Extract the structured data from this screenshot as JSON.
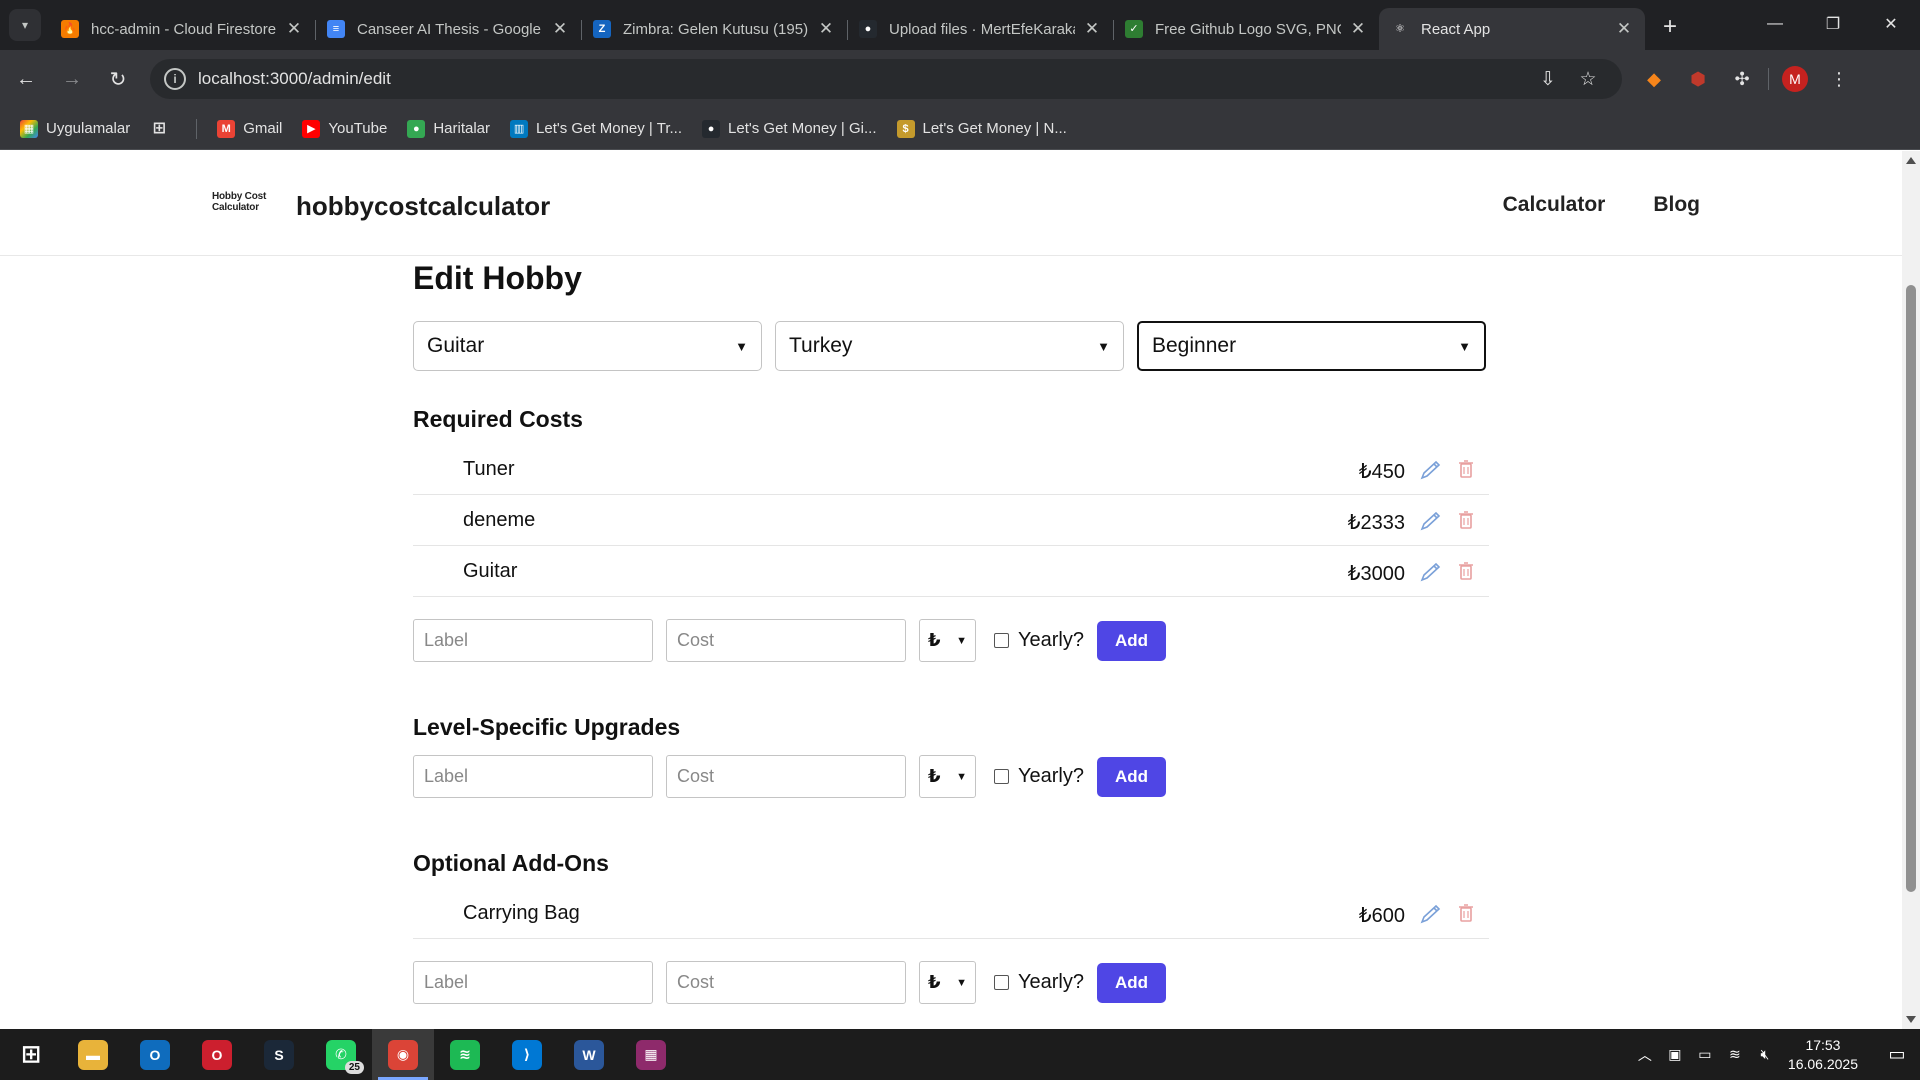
{
  "browser": {
    "tabs": [
      {
        "title": "hcc-admin - Cloud Firestore",
        "favicon_color": "#f57c00",
        "favicon_glyph": "🔥",
        "icon": "firebase-icon"
      },
      {
        "title": "Canseer AI Thesis - Google Docs",
        "favicon_color": "#4285f4",
        "favicon_glyph": "≡",
        "icon": "google-docs-icon"
      },
      {
        "title": "Zimbra: Gelen Kutusu (195)",
        "favicon_color": "#1565c0",
        "favicon_glyph": "Z",
        "icon": "zimbra-icon"
      },
      {
        "title": "Upload files · MertEfeKaraka",
        "favicon_color": "#24292f",
        "favicon_glyph": "●",
        "icon": "github-icon"
      },
      {
        "title": "Free Github Logo SVG, PNG",
        "favicon_color": "#2e7d32",
        "favicon_glyph": "✓",
        "icon": "svgrepo-icon"
      },
      {
        "title": "React App",
        "favicon_color": "#35363a",
        "favicon_glyph": "⚛",
        "icon": "react-icon",
        "active": true
      }
    ],
    "url": "localhost:3000/admin/edit",
    "bookmarks": [
      {
        "label": "Uygulamalar",
        "color": "#ea4335",
        "glyph": "⋮⋮",
        "icon": "apps-grid-icon"
      },
      {
        "label": "Gmail",
        "color": "#ea4335",
        "glyph": "M",
        "icon": "gmail-icon"
      },
      {
        "label": "YouTube",
        "color": "#ff0000",
        "glyph": "▶",
        "icon": "youtube-icon"
      },
      {
        "label": "Haritalar",
        "color": "#34a853",
        "glyph": "●",
        "icon": "maps-icon"
      },
      {
        "label": "Let's Get Money | Tr...",
        "color": "#0079bf",
        "glyph": "▥",
        "icon": "trello-icon"
      },
      {
        "label": "Let's Get Money | Gi...",
        "color": "#24292f",
        "glyph": "●",
        "icon": "github-icon"
      },
      {
        "label": "Let's Get Money | N...",
        "color": "#c49a2c",
        "glyph": "$",
        "icon": "money-bag-icon"
      }
    ]
  },
  "site": {
    "logo_line1": "Hobby Cost",
    "logo_line2": "Calculator",
    "brand": "hobbycostcalculator",
    "nav": [
      "Calculator",
      "Blog"
    ]
  },
  "editor": {
    "title": "Edit Hobby",
    "hobby": "Guitar",
    "country": "Turkey",
    "level": "Beginner",
    "placeholders": {
      "label": "Label",
      "cost": "Cost"
    },
    "currency": "₺",
    "yearly_label": "Yearly?",
    "add_label": "Add",
    "sections": [
      {
        "title": "Required Costs",
        "items": [
          {
            "label": "Tuner",
            "cost": "₺450"
          },
          {
            "label": "deneme",
            "cost": "₺2333"
          },
          {
            "label": "Guitar",
            "cost": "₺3000"
          }
        ]
      },
      {
        "title": "Level-Specific Upgrades",
        "items": []
      },
      {
        "title": "Optional Add-Ons",
        "items": [
          {
            "label": "Carrying Bag",
            "cost": "₺600"
          }
        ]
      }
    ],
    "colors": {
      "accent": "#4f46e5",
      "edit_icon": "#7aa0d8",
      "delete_icon": "#e8a0a0"
    }
  },
  "taskbar": {
    "apps": [
      {
        "name": "windows-start-icon",
        "glyph": "⊞",
        "color": "transparent"
      },
      {
        "name": "file-explorer-icon",
        "glyph": "▬",
        "color": "#e8b33a"
      },
      {
        "name": "outlook-icon",
        "glyph": "O",
        "color": "#0f6cbd"
      },
      {
        "name": "opera-icon",
        "glyph": "O",
        "color": "#cc1f2e"
      },
      {
        "name": "steam-icon",
        "glyph": "S",
        "color": "#1b2838"
      },
      {
        "name": "whatsapp-icon",
        "glyph": "✆",
        "color": "#25d366",
        "badge": "25"
      },
      {
        "name": "chrome-icon",
        "glyph": "◉",
        "color": "#db4437",
        "active": true
      },
      {
        "name": "spotify-icon",
        "glyph": "≋",
        "color": "#1db954"
      },
      {
        "name": "vscode-icon",
        "glyph": "⟩",
        "color": "#0078d4"
      },
      {
        "name": "word-icon",
        "glyph": "W",
        "color": "#2b579a"
      },
      {
        "name": "winrar-icon",
        "glyph": "▦",
        "color": "#8e2a6b"
      }
    ],
    "time": "17:53",
    "date": "16.06.2025"
  }
}
